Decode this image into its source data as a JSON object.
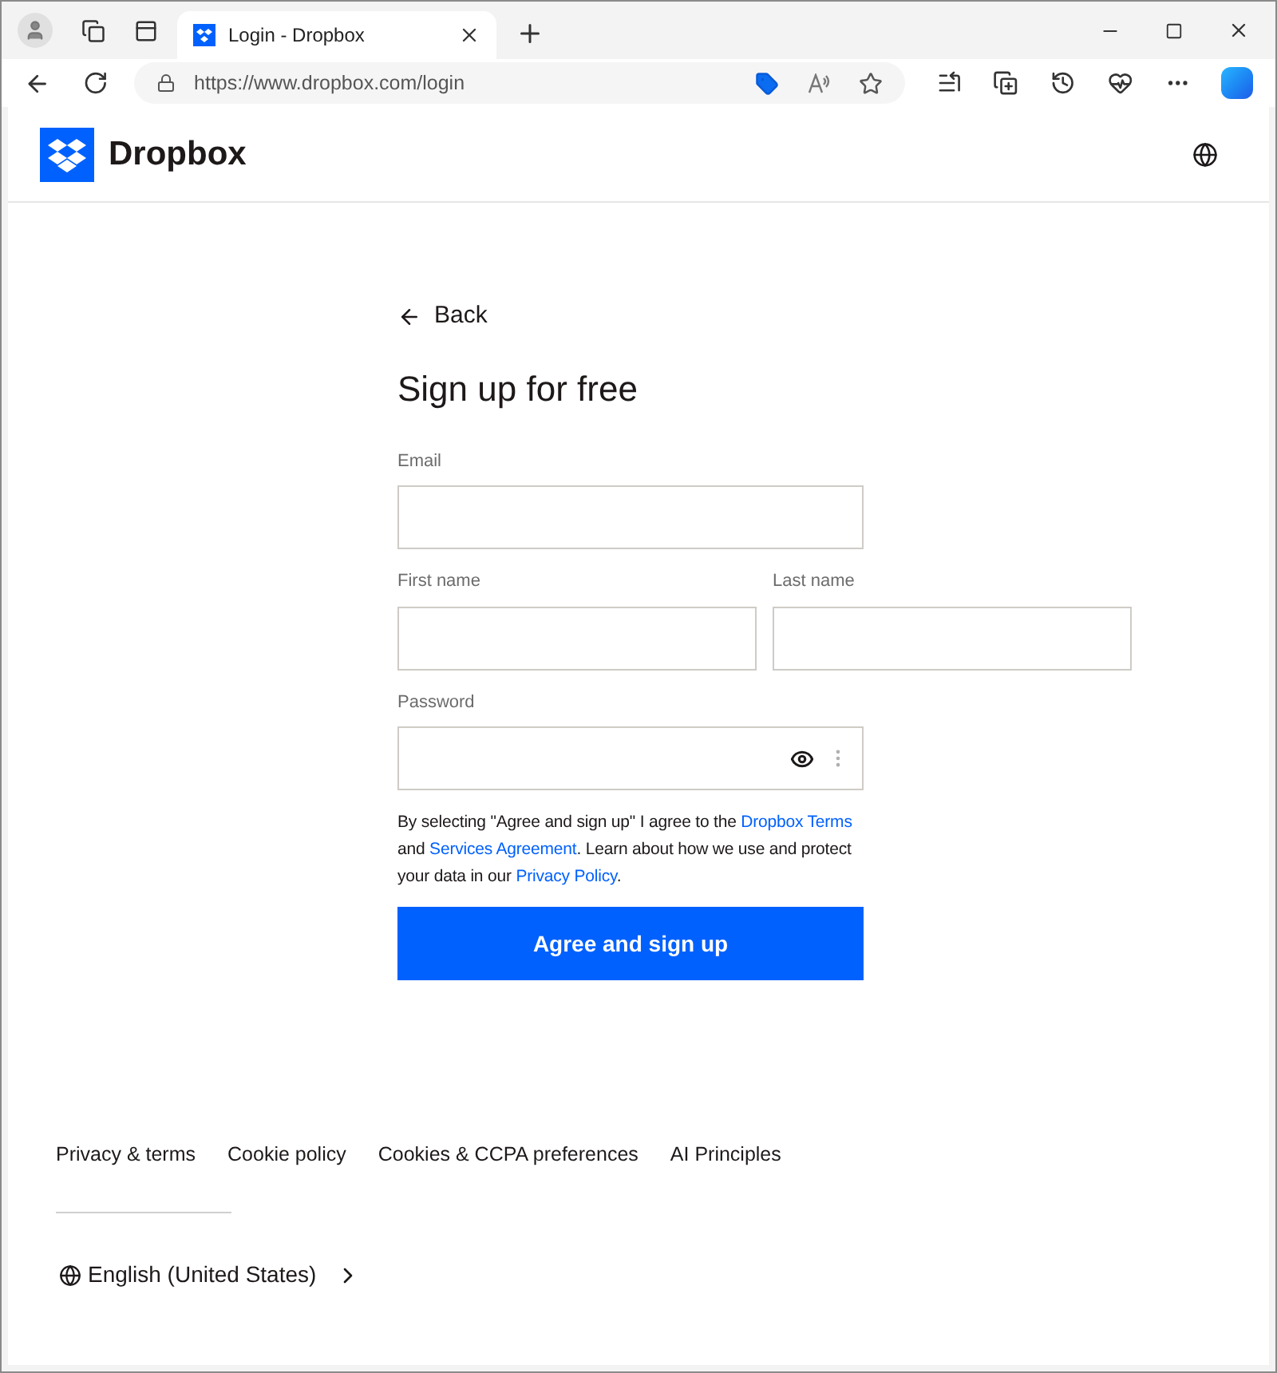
{
  "browser": {
    "tab_title": "Login - Dropbox",
    "url": "https://www.dropbox.com/login"
  },
  "header": {
    "brand": "Dropbox"
  },
  "form": {
    "back": "Back",
    "title": "Sign up for free",
    "fields": [
      {
        "label": "Email",
        "kind": "text"
      },
      {
        "label": "First name",
        "kind": "text"
      },
      {
        "label": "Last name",
        "kind": "text"
      },
      {
        "label": "Password",
        "kind": "password"
      }
    ],
    "terms": [
      {
        "kind": "text",
        "text": "By selecting \"Agree and sign up\" I agree to the "
      },
      {
        "kind": "link",
        "text": "Dropbox Terms"
      },
      {
        "kind": "text",
        "text": " and "
      },
      {
        "kind": "link",
        "text": "Services Agreement"
      },
      {
        "kind": "text",
        "text": ". Learn about how we use and protect your data in our "
      },
      {
        "kind": "link",
        "text": "Privacy Policy"
      },
      {
        "kind": "text",
        "text": "."
      }
    ],
    "submit": "Agree and sign up"
  },
  "footer": {
    "links": [
      "Privacy & terms",
      "Cookie policy",
      "Cookies & CCPA preferences",
      "AI Principles"
    ],
    "language": "English (United States)"
  }
}
